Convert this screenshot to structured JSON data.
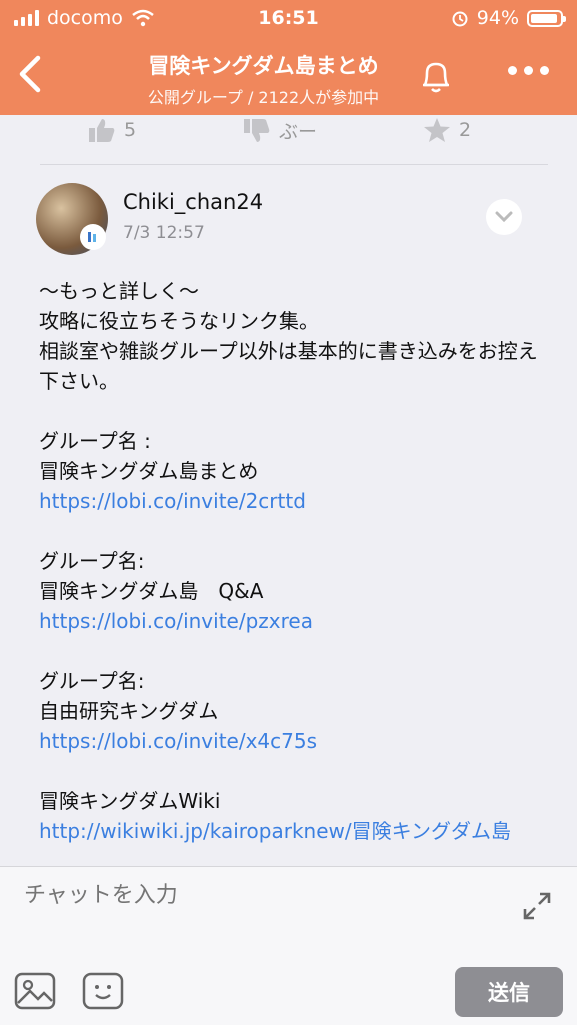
{
  "status_bar": {
    "carrier": "docomo",
    "time": "16:51",
    "battery": "94%",
    "battery_level": 0.94
  },
  "header": {
    "title": "冒険キングダム島まとめ",
    "subtitle": "公開グループ / 2122人が参加中",
    "accent": "#f0875c"
  },
  "reactions": {
    "like_count": "5",
    "dislike_label": "ぶー",
    "star_count": "2"
  },
  "post": {
    "username": "Chiki_chan24",
    "timestamp": "7/3 12:57",
    "intro": [
      "〜もっと詳しく〜",
      "攻略に役立ちそうなリンク集。",
      "相談室や雑談グループ以外は基本的に書き込みをお控え下さい。"
    ],
    "groups": [
      {
        "label": "グループ名 :",
        "name": "冒険キングダム島まとめ",
        "url": "https://lobi.co/invite/2crttd"
      },
      {
        "label": "グループ名:",
        "name": "冒険キングダム島　Q&A",
        "url": "https://lobi.co/invite/pzxrea"
      },
      {
        "label": "グループ名:",
        "name": "自由研究キングダム",
        "url": "https://lobi.co/invite/x4c75s"
      }
    ],
    "wiki_title": "冒険キングダムWiki",
    "wiki_url": "http://wikiwiki.jp/kairoparknew/冒険キングダム島"
  },
  "composer": {
    "placeholder": "チャットを入力",
    "send_label": "送信"
  },
  "icons": [
    "back-icon",
    "bell-icon",
    "more-icon",
    "thumbs-up-icon",
    "thumbs-down-icon",
    "star-icon",
    "chevron-down-icon",
    "expand-icon",
    "image-icon",
    "emoji-icon"
  ]
}
